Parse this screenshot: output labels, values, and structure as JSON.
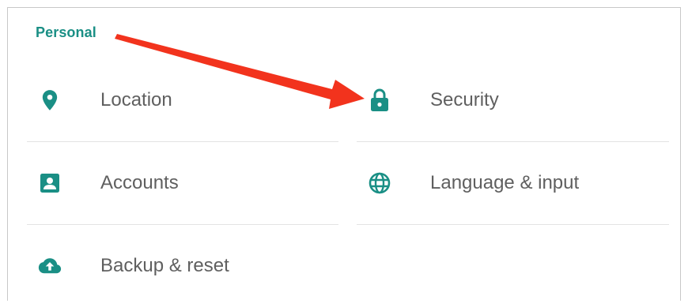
{
  "section": {
    "title": "Personal"
  },
  "items": [
    {
      "label": "Location",
      "icon": "location-pin-icon"
    },
    {
      "label": "Security",
      "icon": "lock-icon"
    },
    {
      "label": "Accounts",
      "icon": "account-box-icon"
    },
    {
      "label": "Language & input",
      "icon": "globe-icon"
    },
    {
      "label": "Backup & reset",
      "icon": "cloud-upload-icon"
    }
  ],
  "colors": {
    "accent": "#1a8f85",
    "text": "#5f5f5f",
    "divider": "#e3e3e3",
    "annotation_arrow": "#f2331d"
  }
}
